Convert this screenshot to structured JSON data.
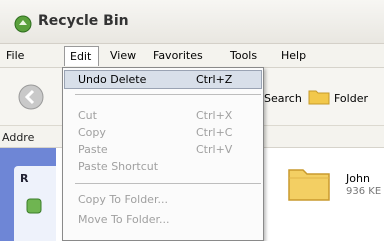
{
  "window": {
    "title": "Recycle Bin"
  },
  "menubar": [
    "File",
    "Edit",
    "View",
    "Favorites",
    "Tools",
    "Help"
  ],
  "toolbar": {
    "search_label": "Search",
    "folders_label": "Folder"
  },
  "addressbar": {
    "label": "Addre"
  },
  "task_panel": {
    "header": "R"
  },
  "file_item": {
    "name": "John",
    "size": "936 KE"
  },
  "edit_menu": {
    "items": [
      {
        "label": "Undo Delete",
        "shortcut": "Ctrl+Z",
        "enabled": true,
        "highlighted": true
      },
      {
        "label": "Cut",
        "shortcut": "Ctrl+X",
        "enabled": false
      },
      {
        "label": "Copy",
        "shortcut": "Ctrl+C",
        "enabled": false
      },
      {
        "label": "Paste",
        "shortcut": "Ctrl+V",
        "enabled": false
      },
      {
        "label": "Paste Shortcut",
        "shortcut": "",
        "enabled": false
      },
      {
        "label": "Copy To Folder...",
        "shortcut": "",
        "enabled": false
      },
      {
        "label": "Move To Folder...",
        "shortcut": "",
        "enabled": false
      }
    ]
  },
  "colors": {
    "menu_highlight": "#d8dfe9",
    "disabled_text": "#a0a0a0",
    "task_pane_blue": "#6e86d6"
  }
}
